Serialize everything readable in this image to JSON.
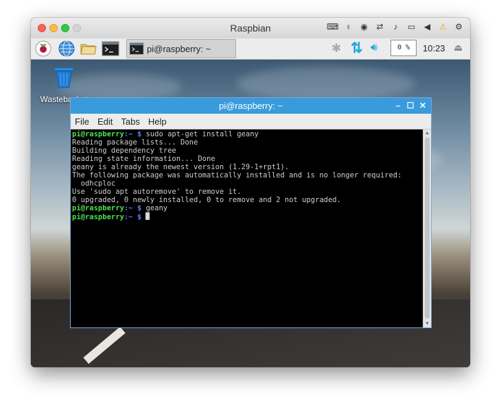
{
  "vm_window": {
    "title": "Raspbian",
    "toolbar_icons": [
      "keyboard-icon",
      "microphone-icon",
      "camera-icon",
      "network-icon",
      "speaker-icon",
      "device-icon",
      "back-icon",
      "warning-icon",
      "gear-icon"
    ]
  },
  "pi_panel": {
    "launchers": [
      "raspberry-menu-icon",
      "web-browser-icon",
      "file-manager-icon",
      "terminal-icon"
    ],
    "taskbar_button": "pi@raspberry: ~",
    "tray": {
      "cpu": "0 %",
      "clock": "10:23"
    }
  },
  "desktop": {
    "wastebasket_label": "Wastebasket"
  },
  "terminal": {
    "title": "pi@raspberry: ~",
    "menu": [
      "File",
      "Edit",
      "Tabs",
      "Help"
    ],
    "prompt_user": "pi@raspberry",
    "prompt_path": ":~ $",
    "commands": [
      "sudo apt-get install geany",
      "geany"
    ],
    "output": [
      "Reading package lists... Done",
      "Building dependency tree",
      "Reading state information... Done",
      "geany is already the newest version (1.29-1+rpt1).",
      "The following package was automatically installed and is no longer required:",
      "  odhcploc",
      "Use 'sudo apt autoremove' to remove it.",
      "0 upgraded, 0 newly installed, 0 to remove and 2 not upgraded."
    ]
  },
  "colors": {
    "prompt_user": "#4ee04e",
    "prompt_path": "#5b7cff",
    "titlebar_blue": "#3a9bdc",
    "tray_blue": "#1aa7e0"
  }
}
